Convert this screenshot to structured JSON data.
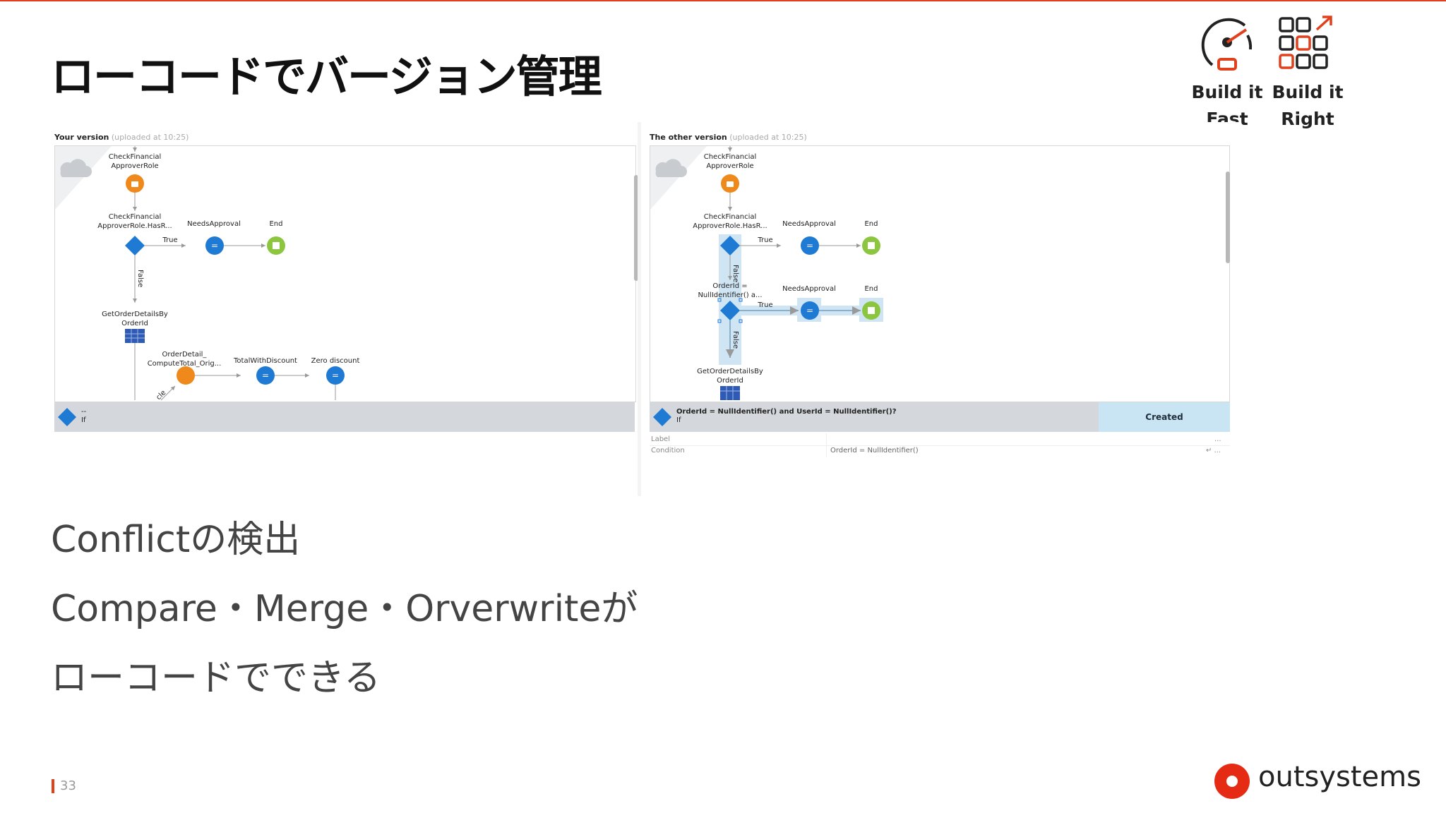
{
  "slide": {
    "title": "ローコードでバージョン管理",
    "badges": [
      {
        "line1": "Build it",
        "line2": "Fast",
        "icon": "speedometer-icon"
      },
      {
        "line1": "Build it",
        "line2": "Right",
        "icon": "grid-arrow-icon"
      }
    ],
    "bullets": [
      "Conflictの検出",
      "Compare・Merge・Orverwriteが",
      "ローコードでできる"
    ],
    "page_number": "33",
    "logo_text": "outsystems",
    "colors": {
      "accent": "#e0401c",
      "logo_red": "#e52b13",
      "node_blue": "#1f7ad4",
      "node_orange": "#f0891c",
      "node_green": "#8cc63f"
    }
  },
  "left_panel": {
    "label": "Your version",
    "uploaded": "(uploaded at 10:25)",
    "nodes": {
      "n1": "CheckFinancial",
      "n1b": "ApproverRole",
      "n2": "CheckFinancial",
      "n2b": "ApproverRole.HasR...",
      "true": "True",
      "needs": "NeedsApproval",
      "end": "End",
      "false": "False",
      "n3": "GetOrderDetailsBy",
      "n3b": "OrderId",
      "n4": "OrderDetail_",
      "n4b": "ComputeTotal_Orig...",
      "n5": "TotalWithDiscount",
      "n6": "Zero discount",
      "partial": "cle"
    },
    "bar_line1": "--",
    "bar_line2": "If"
  },
  "right_panel": {
    "label": "The other version",
    "uploaded": "(uploaded at 10:25)",
    "nodes": {
      "n1": "CheckFinancial",
      "n1b": "ApproverRole",
      "n2": "CheckFinancial",
      "n2b": "ApproverRole.HasR...",
      "true": "True",
      "needs": "NeedsApproval",
      "end": "End",
      "false": "False",
      "n7": "OrderId =",
      "n7b": "NullIdentifier() a...",
      "true2": "True",
      "needs2": "NeedsApproval",
      "end2": "End",
      "false2": "False",
      "n3": "GetOrderDetailsBy",
      "n3b": "OrderId"
    },
    "bar_line1": "OrderId = NullIdentifier()  and  UserId = NullIdentifier()?",
    "bar_line2": "If",
    "status": "Created",
    "props": [
      {
        "label": "Label",
        "value": "",
        "extra": "..."
      },
      {
        "label": "Condition",
        "value": "OrderId = NullIdentifier()",
        "extra": "↵ ..."
      }
    ]
  }
}
